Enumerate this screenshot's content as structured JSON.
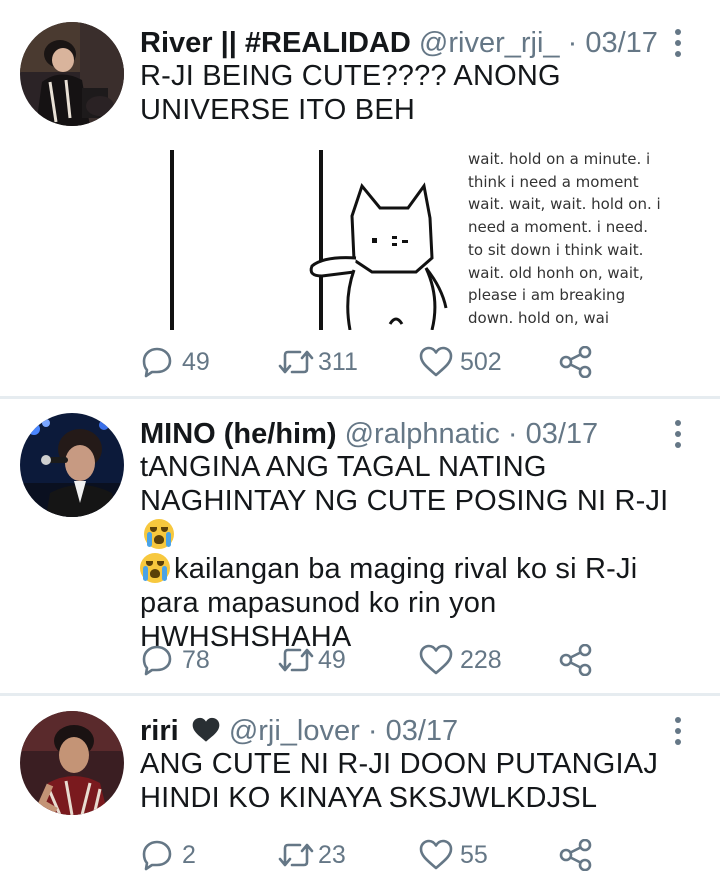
{
  "tweets": [
    {
      "name": "River || #REALIDAD",
      "handle": "@river_rji_",
      "separator": "·",
      "date": "03/17",
      "text": "R-JI BEING CUTE???? ANONG UNIVERSE ITO BEH",
      "media": {
        "lines": [
          "wait. hold on a minute. i",
          "think i need a moment",
          "wait. wait, wait. hold on. i",
          "need a moment. i need.",
          "to sit down i think wait.",
          "wait. old honh on, wait,",
          "please i am breaking",
          "down. hold on, wai"
        ]
      },
      "replies": "49",
      "retweets": "311",
      "likes": "502"
    },
    {
      "name": "MINO (he/him)",
      "handle": "@ralphnatic",
      "separator": "·",
      "date": "03/17",
      "text_line1": "tANGINA ANG TAGAL NATING",
      "text_line2": "NAGHINTAY NG CUTE POSING NI R-JI",
      "text_line3": "kailangan ba maging rival ko si R-Ji",
      "text_line4": "para mapasunod ko rin yon",
      "text_line5": "HWHSHSHAHA",
      "emoji": "loudly-crying-face",
      "replies": "78",
      "retweets": "49",
      "likes": "228"
    },
    {
      "name": "riri",
      "handle": "@rji_lover",
      "separator": "·",
      "date": "03/17",
      "text_line1": "ANG CUTE NI R-JI DOON PUTANGIAJ",
      "text_line2": "HINDI KO KINAYA SKSJWLKDJSL",
      "emoji": "black-heart",
      "replies": "2",
      "retweets": "23",
      "likes": "55"
    }
  ],
  "colors": {
    "text": "#14171a",
    "secondary": "#657786",
    "divider": "#e6ecf0"
  }
}
